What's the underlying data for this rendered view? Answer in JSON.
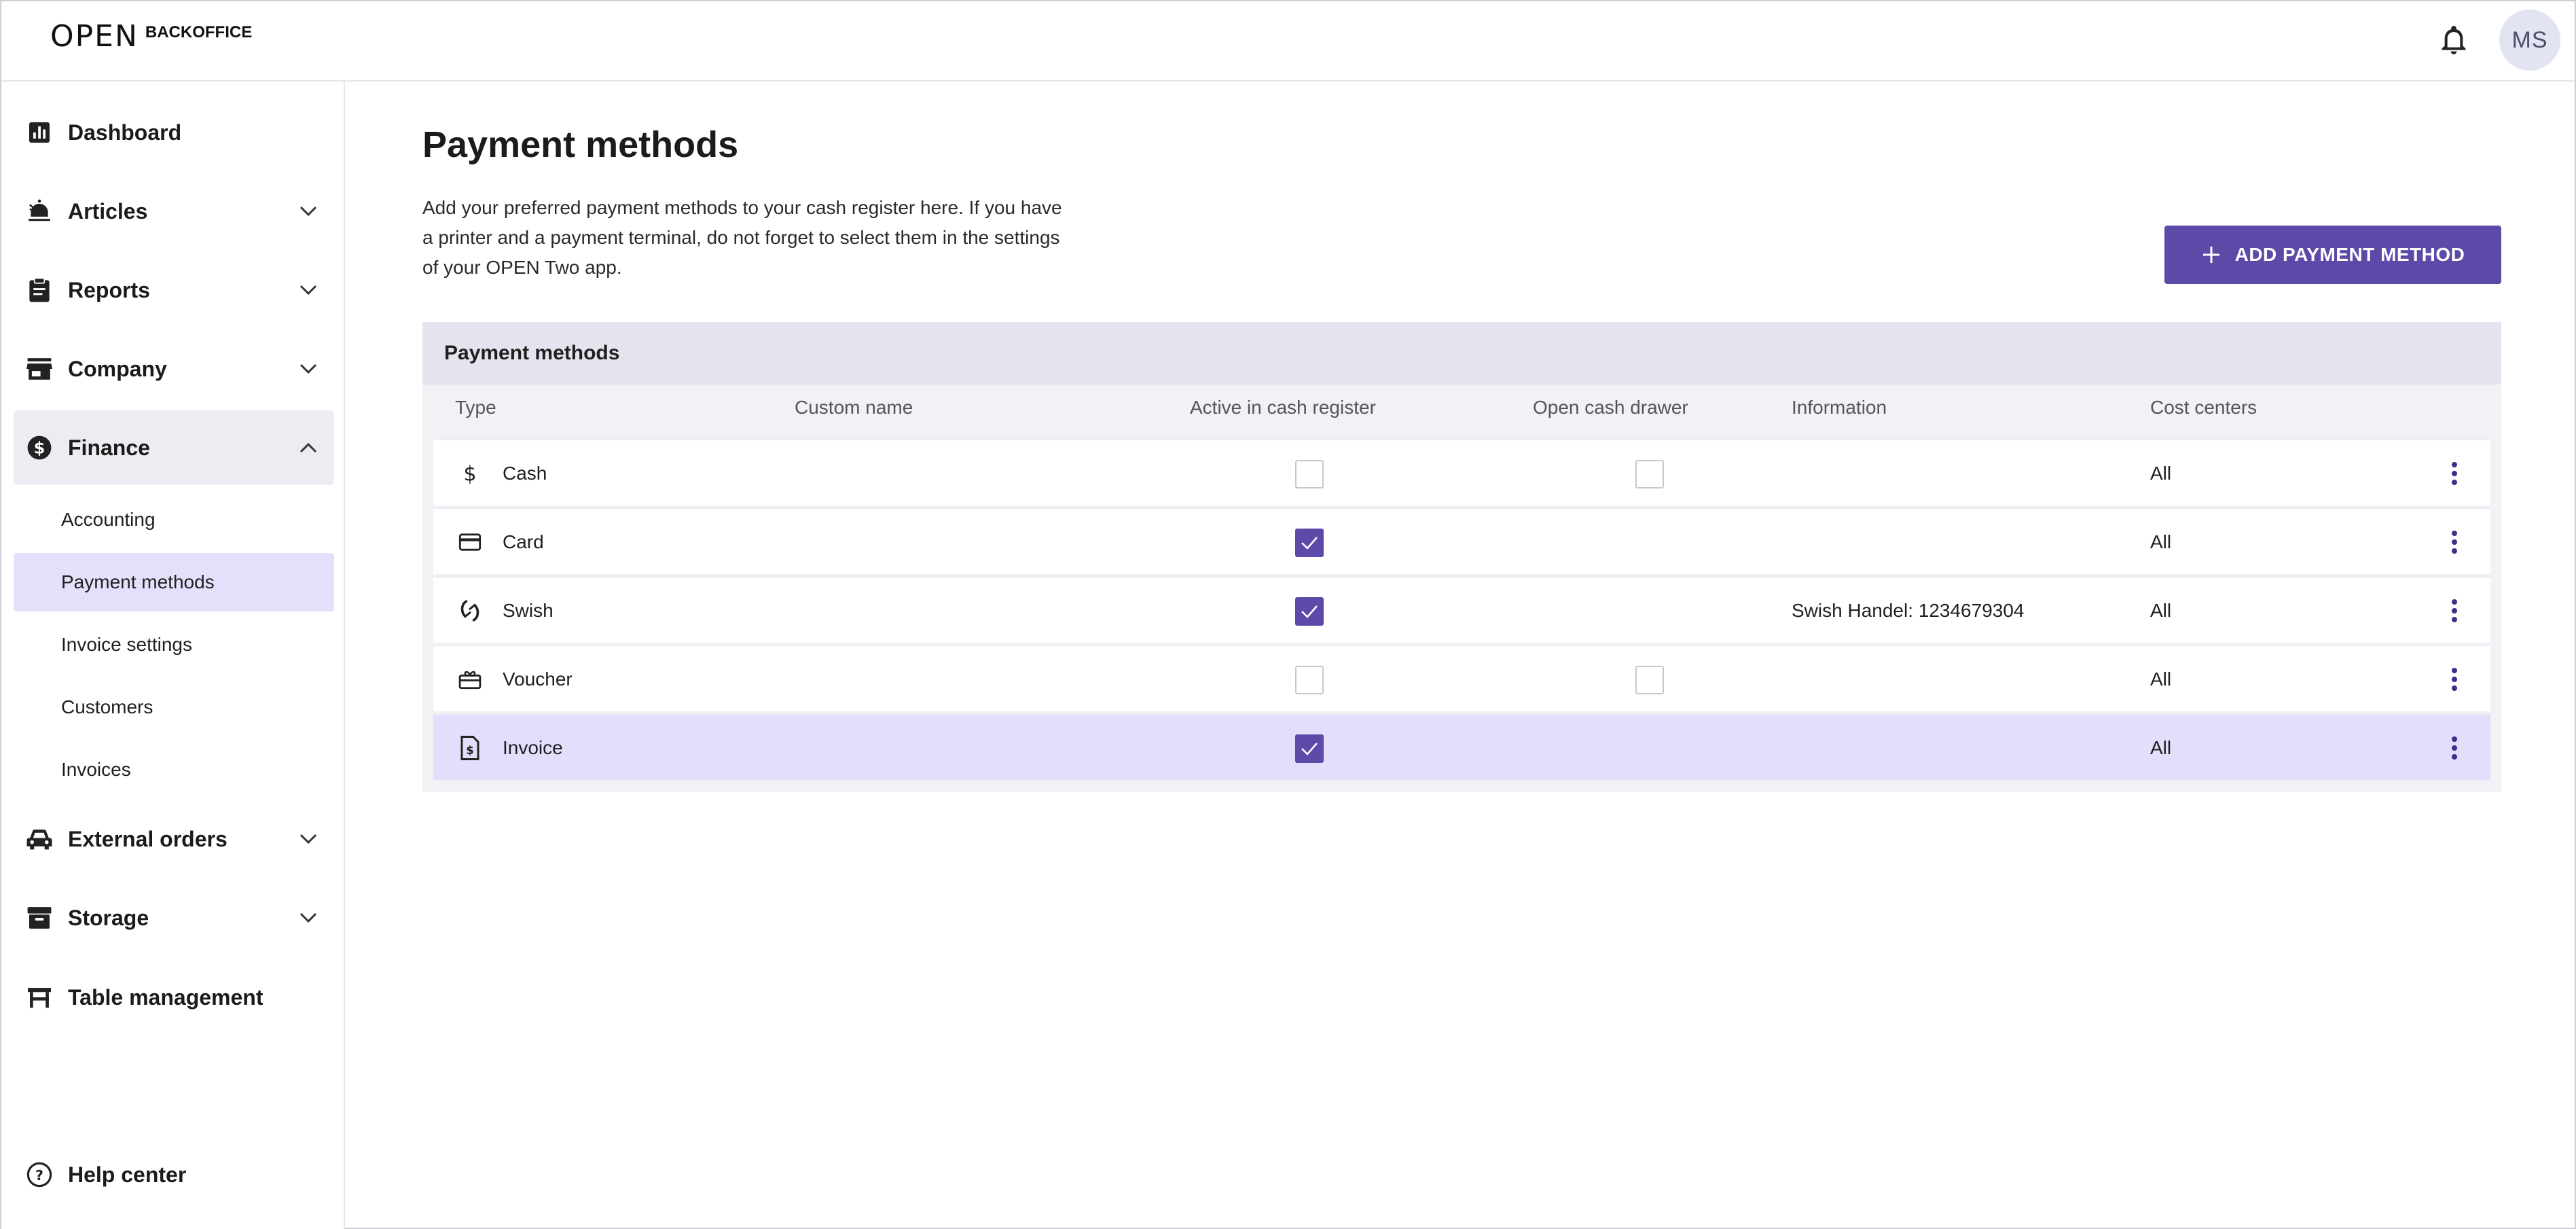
{
  "header": {
    "logo_mark": "OPEN",
    "logo_text": "BACKOFFICE",
    "avatar_initials": "MS"
  },
  "sidebar": {
    "items": [
      {
        "label": "Dashboard",
        "icon": "bar-chart-icon",
        "expandable": false
      },
      {
        "label": "Articles",
        "icon": "food-icon",
        "expandable": true
      },
      {
        "label": "Reports",
        "icon": "clipboard-icon",
        "expandable": true
      },
      {
        "label": "Company",
        "icon": "store-icon",
        "expandable": true
      },
      {
        "label": "Finance",
        "icon": "dollar-circle-icon",
        "expandable": true,
        "expanded": true
      },
      {
        "label": "External orders",
        "icon": "car-icon",
        "expandable": true
      },
      {
        "label": "Storage",
        "icon": "archive-icon",
        "expandable": true
      },
      {
        "label": "Table management",
        "icon": "table-icon",
        "expandable": false
      }
    ],
    "finance_subitems": [
      {
        "label": "Accounting"
      },
      {
        "label": "Payment methods",
        "selected": true
      },
      {
        "label": "Invoice settings"
      },
      {
        "label": "Customers"
      },
      {
        "label": "Invoices"
      }
    ],
    "help": {
      "label": "Help center",
      "icon": "help-circle-icon"
    }
  },
  "main": {
    "title": "Payment methods",
    "description": "Add your preferred payment methods to your cash register here. If you have a printer and a payment terminal, do not forget to select them in the settings of your OPEN Two app.",
    "add_button_label": "ADD PAYMENT METHOD",
    "table": {
      "title": "Payment methods",
      "columns": [
        "Type",
        "Custom name",
        "Active in cash register",
        "Open cash drawer",
        "Information",
        "Cost centers"
      ],
      "rows": [
        {
          "type": "Cash",
          "icon": "dollar-icon",
          "custom_name": "",
          "active": false,
          "drawer": false,
          "information": "",
          "cost_centers": "All"
        },
        {
          "type": "Card",
          "icon": "credit-card-icon",
          "custom_name": "",
          "active": true,
          "drawer": null,
          "information": "",
          "cost_centers": "All"
        },
        {
          "type": "Swish",
          "icon": "swish-icon",
          "custom_name": "",
          "active": true,
          "drawer": null,
          "information": "Swish Handel: 1234679304",
          "cost_centers": "All"
        },
        {
          "type": "Voucher",
          "icon": "gift-card-icon",
          "custom_name": "",
          "active": false,
          "drawer": false,
          "information": "",
          "cost_centers": "All"
        },
        {
          "type": "Invoice",
          "icon": "invoice-icon",
          "custom_name": "",
          "active": true,
          "drawer": null,
          "information": "",
          "cost_centers": "All",
          "highlighted": true
        }
      ]
    }
  },
  "colors": {
    "accent": "#5d4aa8",
    "selected_bg": "#e4e0fb",
    "panel_bg": "#f1f1f6",
    "panel_header_bg": "#e4e4ef"
  }
}
